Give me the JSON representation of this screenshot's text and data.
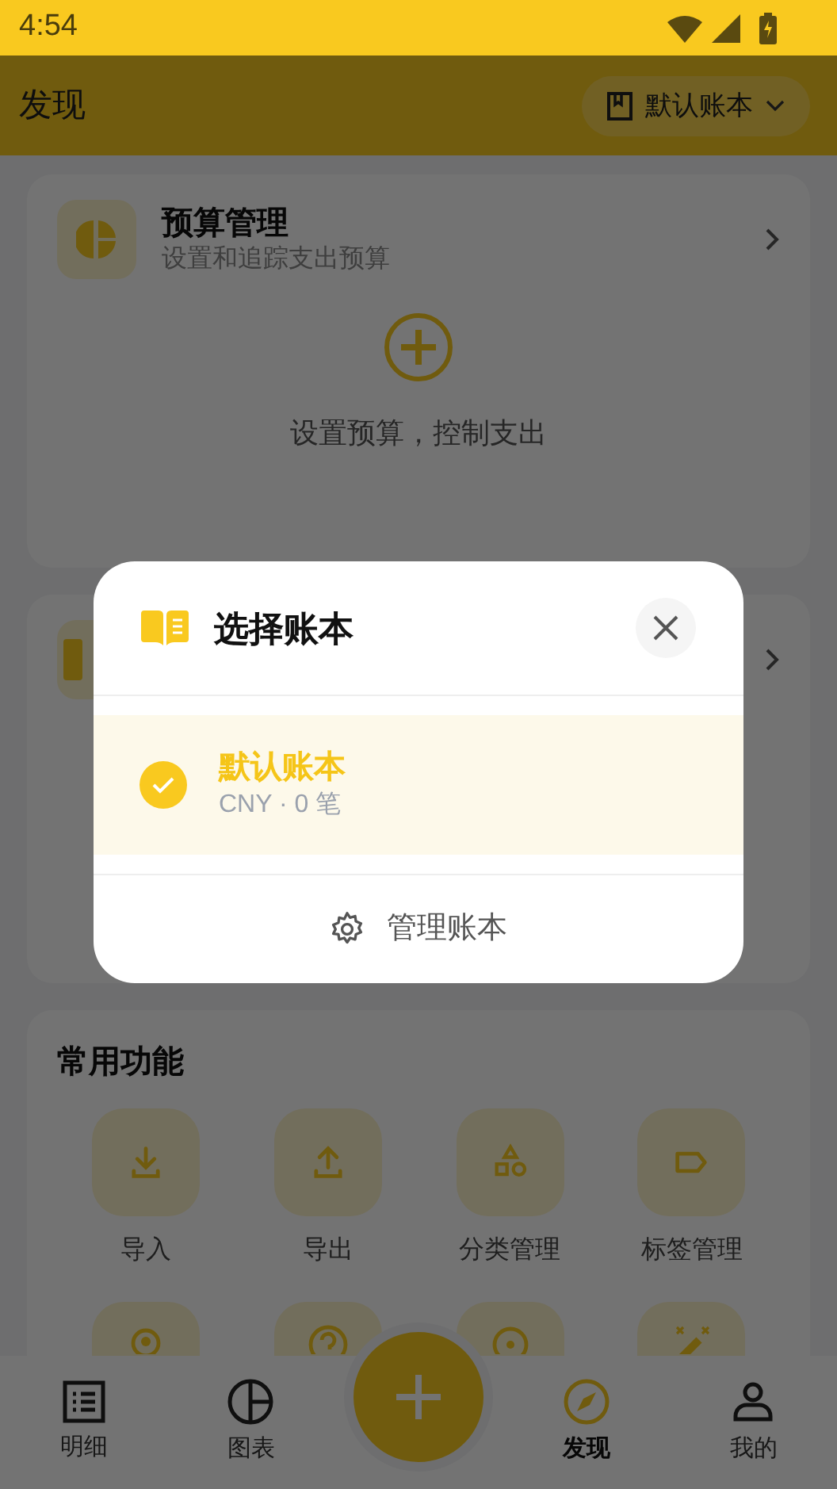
{
  "status_bar": {
    "time": "4:54"
  },
  "header": {
    "title": "发现",
    "book_selector": {
      "label": "默认账本"
    }
  },
  "budget_card": {
    "title": "预算管理",
    "subtitle": "设置和追踪支出预算",
    "empty_text": "设置预算，控制支出"
  },
  "common_functions": {
    "title": "常用功能",
    "items": [
      {
        "label": "导入"
      },
      {
        "label": "导出"
      },
      {
        "label": "分类管理"
      },
      {
        "label": "标签管理"
      }
    ]
  },
  "bottom_nav": [
    {
      "label": "明细",
      "selected": false
    },
    {
      "label": "图表",
      "selected": false
    },
    {
      "label": "发现",
      "selected": true
    },
    {
      "label": "我的",
      "selected": false
    }
  ],
  "dialog": {
    "title": "选择账本",
    "books": [
      {
        "name": "默认账本",
        "meta": "CNY · 0 笔",
        "selected": true
      }
    ],
    "manage_button": "管理账本"
  }
}
